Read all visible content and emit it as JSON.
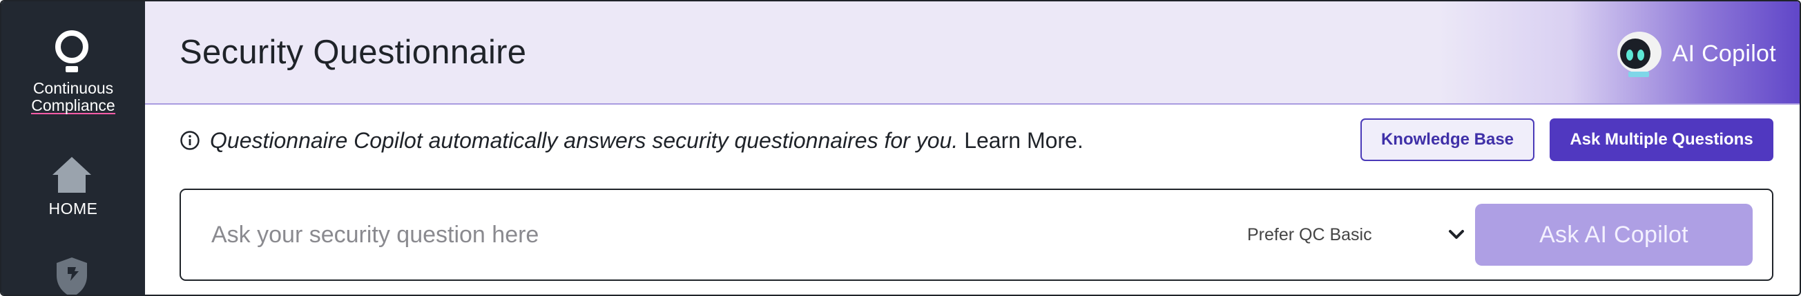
{
  "app": {
    "brand_line1": "Continuous",
    "brand_line2": "Compliance"
  },
  "sidebar": {
    "items": [
      {
        "label": "HOME",
        "icon": "home-icon"
      },
      {
        "label": "",
        "icon": "shield-icon"
      }
    ]
  },
  "header": {
    "title": "Security Questionnaire",
    "copilot_label": "AI Copilot"
  },
  "info": {
    "text": "Questionnaire Copilot automatically answers security questionnaires for you.",
    "link": "Learn More."
  },
  "actions": {
    "knowledge_base": "Knowledge Base",
    "ask_multiple": "Ask Multiple Questions"
  },
  "ask": {
    "placeholder": "Ask your security question here",
    "value": "",
    "model_selected": "Prefer QC Basic",
    "submit_label": "Ask AI Copilot"
  },
  "colors": {
    "sidebar_bg": "#222831",
    "header_bg": "#ece8f7",
    "accent": "#5038c0",
    "disabled_button": "#ae9fe4",
    "brand_underline": "#ff5ca8"
  }
}
